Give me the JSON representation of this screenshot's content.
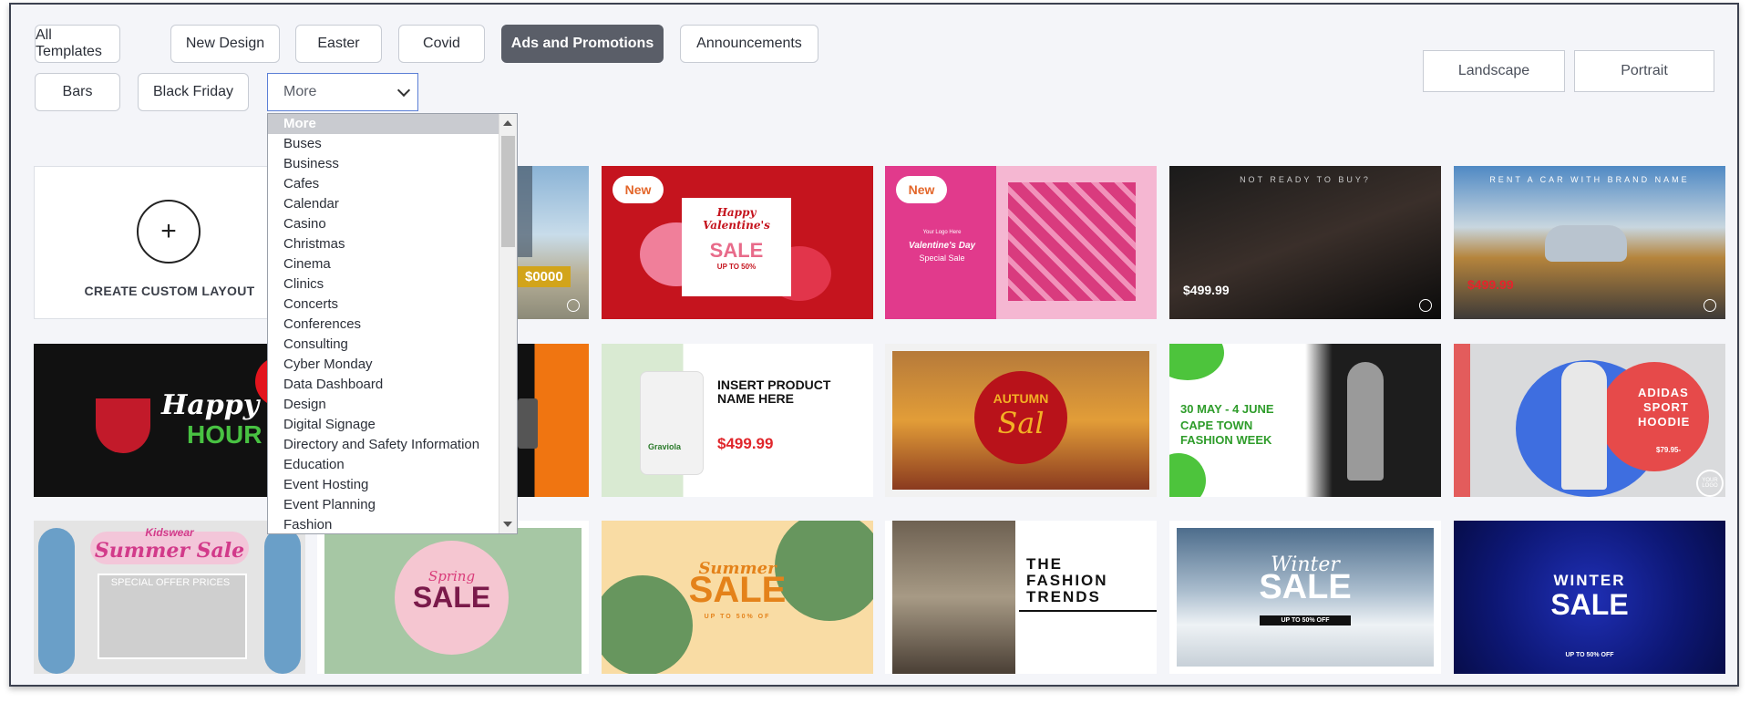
{
  "categories": [
    "All Templates",
    "New Design",
    "Easter",
    "Covid",
    "Ads and Promotions",
    "Announcements",
    "Bars",
    "Black Friday"
  ],
  "active_category": "Ads and Promotions",
  "more_select": {
    "value": "More"
  },
  "orientation": {
    "landscape": "Landscape",
    "portrait": "Portrait"
  },
  "dropdown_options": [
    "More",
    "Buses",
    "Business",
    "Cafes",
    "Calendar",
    "Casino",
    "Christmas",
    "Cinema",
    "Clinics",
    "Concerts",
    "Conferences",
    "Consulting",
    "Cyber Monday",
    "Data Dashboard",
    "Design",
    "Digital Signage",
    "Directory and Safety Information",
    "Education",
    "Event Hosting",
    "Event Planning",
    "Fashion"
  ],
  "custom_layout": {
    "label": "CREATE CUSTOM LAYOUT",
    "plus": "+"
  },
  "templates": {
    "t1_price": "$0000",
    "t2": {
      "badge": "New",
      "line1": "Happy",
      "line2": "Valentine's",
      "sale": "SALE",
      "sub": "UP TO 50%"
    },
    "t3": {
      "badge": "New",
      "logo": "Your Logo Here",
      "title": "Valentine's Day",
      "sub": "Special Sale"
    },
    "t4": {
      "top": "NOT READY TO BUY?",
      "price": "$499.99"
    },
    "t5": {
      "top": "RENT A CAR WITH BRAND NAME",
      "price": "$499.99"
    },
    "t6": {
      "happy": "Happy",
      "hour": "HOUR"
    },
    "t8": {
      "title": "INSERT PRODUCT NAME HERE",
      "price": "$499.99",
      "brand": "Graviola"
    },
    "t9": {
      "title": "AUTUMN",
      "script": "Sal"
    },
    "t10": {
      "date": "30 MAY - 4 JUNE",
      "line2": "CAPE TOWN",
      "line3": "FASHION WEEK"
    },
    "t11": {
      "line1": "ADIDAS",
      "line2": "SPORT",
      "line3": "HOODIE",
      "price": "$79.95-",
      "logo": "YOUR LOGO"
    },
    "t12": {
      "brand": "Kidswear",
      "title": "Summer Sale",
      "offers": "SPECIAL OFFER PRICES"
    },
    "t13": {
      "spring": "Spring",
      "sale": "SALE"
    },
    "t14": {
      "summer": "Summer",
      "sale": "SALE",
      "sub": "UP TO 50% OF"
    },
    "t15": {
      "line1": "THE",
      "line2": "FASHION",
      "line3": "TRENDS"
    },
    "t16": {
      "winter": "Winter",
      "sale": "SALE",
      "sub": "UP TO 50% OFF"
    },
    "t17": {
      "winter": "WINTER",
      "sale": "SALE",
      "sub": "UP TO 50% OFF"
    }
  },
  "colors": {
    "accent": "#5a5e68",
    "focus_border": "#5b7fd6",
    "badge_text": "#e3662a"
  }
}
